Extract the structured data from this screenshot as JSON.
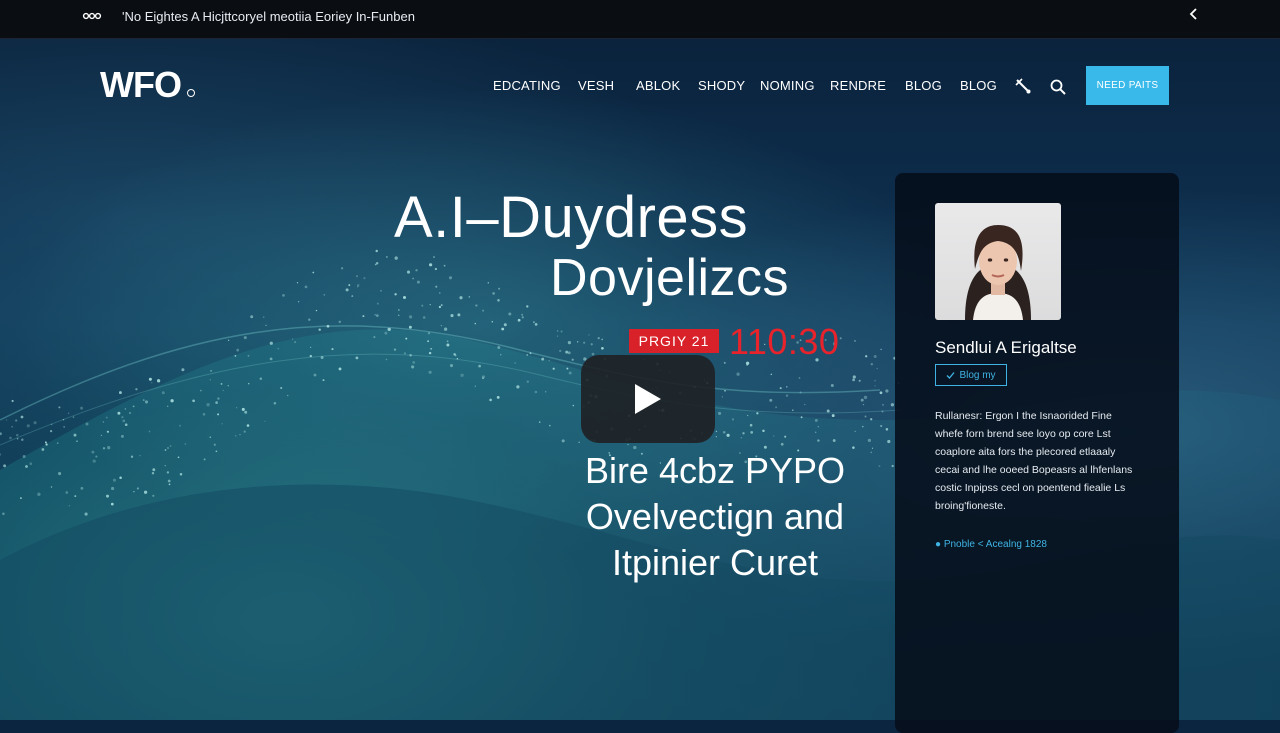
{
  "top_bar": {
    "ticker": "'No Eightes A Hicjttcoryel meotiia Eoriey In-Funben",
    "ticker_icon": "signal-icon",
    "collapse_icon": "chevron-left-icon"
  },
  "header": {
    "logo": "WFO",
    "nav": [
      "EDCATING",
      "VESH",
      "ABLOK",
      "SHODY",
      "NOMING",
      "RENDRE",
      "BLOG",
      "BLOG"
    ],
    "tool_icon": "tools-icon",
    "search_icon": "search-icon",
    "cta": "NEED PAITS"
  },
  "hero": {
    "title_line1": "A.I–Duydress",
    "title_line2": "Dovjelizcs",
    "date_badge": "PRGIY 21",
    "time": "110:30",
    "play_icon": "play-icon",
    "subtitle": [
      "Bire 4cbz PYPO",
      "Ovelvectign and",
      "Itpinier Curet"
    ]
  },
  "card": {
    "name": "Sendlui A Erigaltse",
    "tag": "Blog my",
    "body": [
      "Rullanesr: Ergon I the Isnaorided Fine",
      "whefe forn brend see loyo op core Lst",
      "coaplore aita fors the plecored etlaaaly",
      "cecai and lhe ooeed Bopeasrs al lhfenlans",
      "costic Inpipss cecl on poentend fiealie Ls",
      "broing'fioneste."
    ],
    "meta": "● Pnoble < Acealng 1828"
  },
  "colors": {
    "accent": "#39b9ea",
    "badge_red": "#d9212a",
    "time_red": "#e8232b",
    "card_bg": "#060e1a"
  }
}
